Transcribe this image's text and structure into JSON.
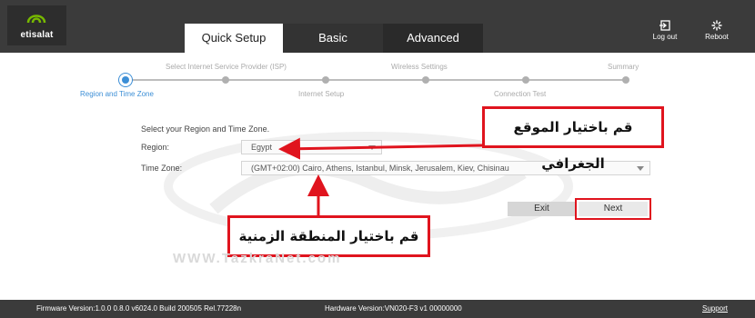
{
  "brand": {
    "name": "etisalat",
    "color": "#77b800"
  },
  "tabs": [
    {
      "label": "Quick Setup",
      "active": true
    },
    {
      "label": "Basic",
      "active": false
    },
    {
      "label": "Advanced",
      "active": false
    }
  ],
  "header_actions": {
    "logout": "Log out",
    "reboot": "Reboot"
  },
  "steps": [
    {
      "label": "Region and Time Zone",
      "active": true
    },
    {
      "label": "Select Internet Service Provider (ISP)",
      "active": false
    },
    {
      "label": "Internet Setup",
      "active": false
    },
    {
      "label": "Wireless Settings",
      "active": false
    },
    {
      "label": "Connection Test",
      "active": false
    },
    {
      "label": "Summary",
      "active": false
    }
  ],
  "form": {
    "instruction": "Select your Region and Time Zone.",
    "region_label": "Region:",
    "region_value": "Egypt",
    "timezone_label": "Time Zone:",
    "timezone_value": "(GMT+02:00) Cairo, Athens, Istanbul, Minsk, Jerusalem, Kiev, Chisinau",
    "exit_label": "Exit",
    "next_label": "Next"
  },
  "annotations": {
    "region_callout": "قم باختيار الموقع الجغرافي",
    "timezone_callout": "قم باختيار المنطقة الزمنية",
    "accent_color": "#e0141e"
  },
  "watermark": "WWW.TazkraNet.com",
  "footer": {
    "firmware": "Firmware Version:1.0.0 0.8.0 v6024.0 Build 200505 Rel.77228n",
    "hardware": "Hardware Version:VN020-F3 v1 00000000",
    "support": "Support"
  }
}
